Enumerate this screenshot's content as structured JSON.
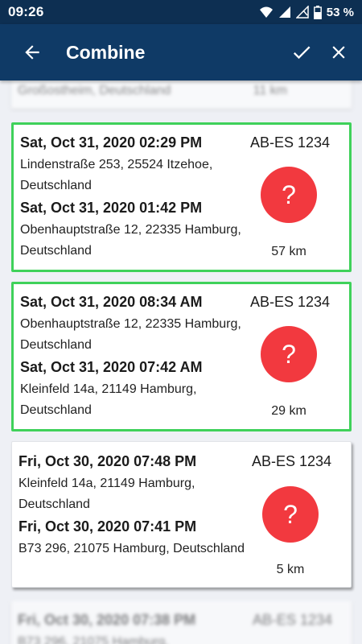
{
  "status_bar": {
    "time": "09:26",
    "battery": "53 %"
  },
  "app_bar": {
    "title": "Combine"
  },
  "top_partial": {
    "address": "Großostheim, Deutschland",
    "distance": "11 km"
  },
  "trips": [
    {
      "start_time": "Sat, Oct 31, 2020 02:29 PM",
      "start_address": "Lindenstraße 253, 25524 Itzehoe, Deutschland",
      "end_time": "Sat, Oct 31, 2020 01:42 PM",
      "end_address": "Obenhauptstraße 12, 22335 Hamburg, Deutschland",
      "plate": "AB-ES 1234",
      "distance": "57 km",
      "status_symbol": "?"
    },
    {
      "start_time": "Sat, Oct 31, 2020 08:34 AM",
      "start_address": "Obenhauptstraße 12, 22335 Hamburg, Deutschland",
      "end_time": "Sat, Oct 31, 2020 07:42 AM",
      "end_address": "Kleinfeld 14a, 21149 Hamburg, Deutschland",
      "plate": "AB-ES 1234",
      "distance": "29 km",
      "status_symbol": "?"
    },
    {
      "start_time": "Fri, Oct 30, 2020 07:48 PM",
      "start_address": "Kleinfeld 14a, 21149 Hamburg, Deutschland",
      "end_time": "Fri, Oct 30, 2020 07:41 PM",
      "end_address": "B73 296, 21075 Hamburg, Deutschland",
      "plate": "AB-ES 1234",
      "distance": "5 km",
      "status_symbol": "?"
    },
    {
      "start_time": "Fri, Oct 30, 2020 07:38 PM",
      "start_address": "B73 296, 21075 Hamburg,",
      "plate": "AB-ES 1234"
    }
  ],
  "colors": {
    "app_bar": "#0f3a66",
    "status_bar": "#0d2f52",
    "selected_border": "#3fd15a",
    "status_button": "#f2393f"
  }
}
